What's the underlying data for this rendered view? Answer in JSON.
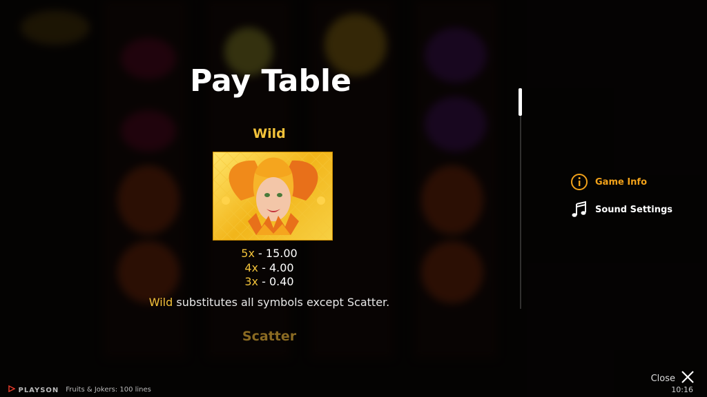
{
  "paytable": {
    "title": "Pay Table",
    "wild": {
      "name": "Wild",
      "pays": [
        {
          "mult": "5x",
          "value": "15.00"
        },
        {
          "mult": "4x",
          "value": "4.00"
        },
        {
          "mult": "3x",
          "value": "0.40"
        }
      ],
      "desc_highlight": "Wild",
      "desc_rest": " substitutes all symbols except Scatter."
    },
    "next_symbol": "Scatter"
  },
  "menu": {
    "game_info": "Game Info",
    "sound_settings": "Sound Settings"
  },
  "footer": {
    "close": "Close",
    "time": "10:16",
    "brand": "PLAYSON",
    "game_name": "Fruits & Jokers: 100 lines"
  },
  "colors": {
    "accent": "#f2c23a",
    "menu_active": "#f2a21a",
    "brand_red": "#e23a2a"
  },
  "icons": {
    "game_info": "info-circle-icon",
    "sound": "music-note-icon",
    "close": "close-x-icon"
  }
}
